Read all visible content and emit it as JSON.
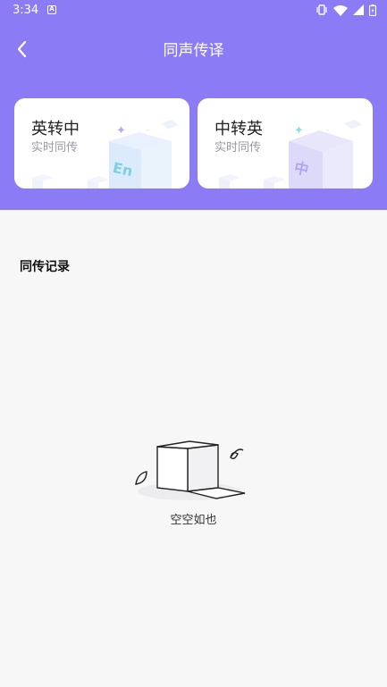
{
  "status_bar": {
    "time": "3:34",
    "notification_icon": "A"
  },
  "nav": {
    "title": "同声传译"
  },
  "cards": [
    {
      "title": "英转中",
      "subtitle": "实时同传",
      "art_letters": "En"
    },
    {
      "title": "中转英",
      "subtitle": "实时同传",
      "art_letters": "中"
    }
  ],
  "records": {
    "title": "同传记录",
    "empty_text": "空空如也"
  },
  "colors": {
    "header_bg": "#8b7cf6",
    "page_bg": "#f7f7f8",
    "card_bg": "#ffffff"
  }
}
